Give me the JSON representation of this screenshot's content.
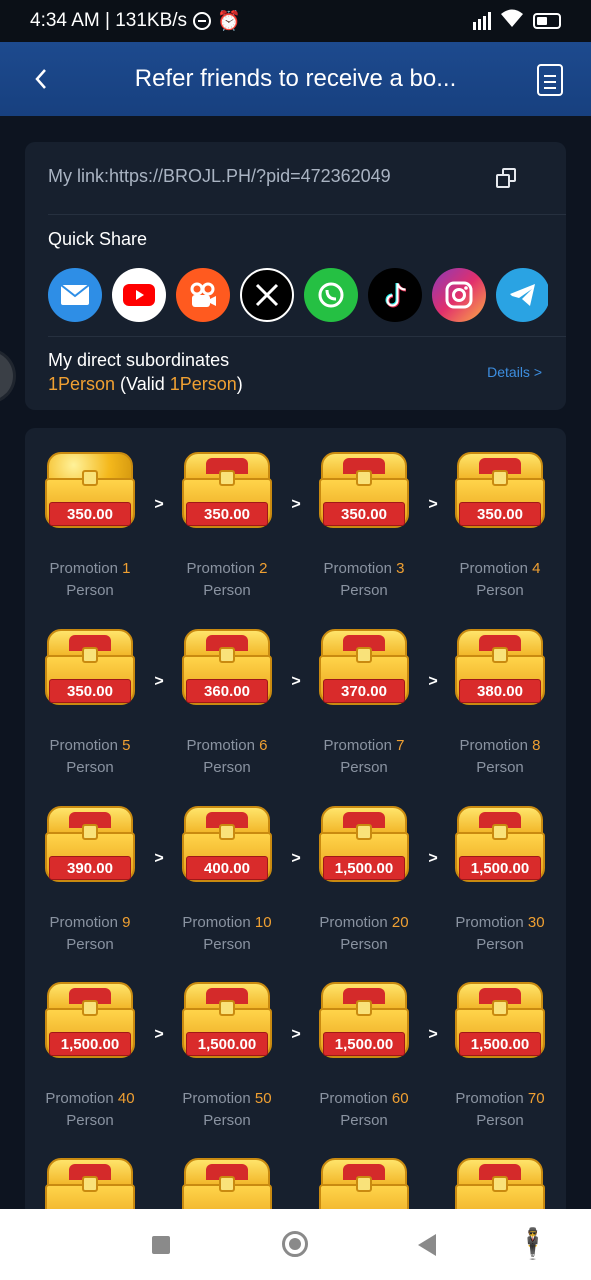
{
  "status_bar": {
    "time_speed": "4:34 AM | 131KB/s"
  },
  "header": {
    "back_icon": "chevron-left-icon",
    "title": "Refer friends to receive a bo...",
    "rules_icon": "document-icon"
  },
  "link_card": {
    "my_link": "My link:https://BROJL.PH/?pid=472362049",
    "quick_share_label": "Quick Share",
    "share_targets": [
      {
        "name": "email",
        "icon": "mail-icon",
        "color": "#2e8ee6"
      },
      {
        "name": "youtube",
        "icon": "youtube-icon",
        "color": "#ffffff"
      },
      {
        "name": "kwai",
        "icon": "kwai-icon",
        "color": "#ff5a1f"
      },
      {
        "name": "x",
        "icon": "x-icon",
        "color": "#000000"
      },
      {
        "name": "whatsapp",
        "icon": "whatsapp-icon",
        "color": "#25c043"
      },
      {
        "name": "tiktok",
        "icon": "tiktok-icon",
        "color": "#000000"
      },
      {
        "name": "instagram",
        "icon": "instagram-icon",
        "color": "#d6336c"
      },
      {
        "name": "telegram",
        "icon": "telegram-icon",
        "color": "#2aa3e3"
      }
    ],
    "subordinates_label": "My direct subordinates",
    "subordinates_count": "1Person",
    "valid_prefix": " (Valid ",
    "valid_count": "1Person",
    "valid_suffix": ")",
    "details_link": "Details >"
  },
  "rewards": [
    {
      "amount": "350.00",
      "label": "Promotion ",
      "n": "1",
      "unit": "Person",
      "style": "gold"
    },
    {
      "amount": "350.00",
      "label": "Promotion ",
      "n": "2",
      "unit": "Person",
      "style": "red"
    },
    {
      "amount": "350.00",
      "label": "Promotion ",
      "n": "3",
      "unit": "Person",
      "style": "red"
    },
    {
      "amount": "350.00",
      "label": "Promotion ",
      "n": "4",
      "unit": "Person",
      "style": "red"
    },
    {
      "amount": "350.00",
      "label": "Promotion ",
      "n": "5",
      "unit": "Person",
      "style": "red"
    },
    {
      "amount": "360.00",
      "label": "Promotion ",
      "n": "6",
      "unit": "Person",
      "style": "red"
    },
    {
      "amount": "370.00",
      "label": "Promotion ",
      "n": "7",
      "unit": "Person",
      "style": "red"
    },
    {
      "amount": "380.00",
      "label": "Promotion ",
      "n": "8",
      "unit": "Person",
      "style": "red"
    },
    {
      "amount": "390.00",
      "label": "Promotion ",
      "n": "9",
      "unit": "Person",
      "style": "red"
    },
    {
      "amount": "400.00",
      "label": "Promotion ",
      "n": "10",
      "unit": "Person",
      "style": "red"
    },
    {
      "amount": "1,500.00",
      "label": "Promotion ",
      "n": "20",
      "unit": "Person",
      "style": "red"
    },
    {
      "amount": "1,500.00",
      "label": "Promotion ",
      "n": "30",
      "unit": "Person",
      "style": "red"
    },
    {
      "amount": "1,500.00",
      "label": "Promotion ",
      "n": "40",
      "unit": "Person",
      "style": "red"
    },
    {
      "amount": "1,500.00",
      "label": "Promotion ",
      "n": "50",
      "unit": "Person",
      "style": "red"
    },
    {
      "amount": "1,500.00",
      "label": "Promotion ",
      "n": "60",
      "unit": "Person",
      "style": "red"
    },
    {
      "amount": "1,500.00",
      "label": "Promotion ",
      "n": "70",
      "unit": "Person",
      "style": "red"
    }
  ],
  "arrow_glyph": ">",
  "nav_bar": {
    "icons": [
      "recents-icon",
      "home-icon",
      "back-icon",
      "accessibility-icon"
    ]
  }
}
